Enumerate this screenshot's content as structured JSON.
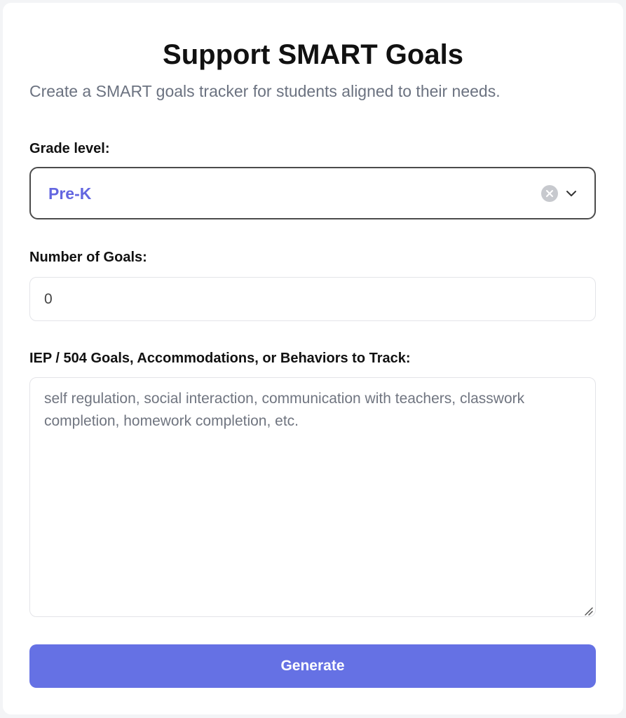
{
  "form": {
    "title": "Support SMART Goals",
    "subtitle": "Create a SMART goals tracker for students aligned to their needs.",
    "grade": {
      "label": "Grade level:",
      "value": "Pre-K",
      "clear_icon": "clear-circle-x-icon",
      "toggle_icon": "chevron-down-icon"
    },
    "goals": {
      "label": "Number of Goals:",
      "value": "0"
    },
    "iep": {
      "label": "IEP / 504 Goals, Accommodations, or Behaviors to Track:",
      "placeholder": "self regulation, social interaction, communication with teachers, classwork completion, homework completion, etc.",
      "value": ""
    },
    "generate_label": "Generate"
  },
  "colors": {
    "accent": "#6571e4",
    "selected_text": "#6366e0",
    "muted_text": "#6b7280",
    "page_background": "#f3f4f6",
    "card_background": "#ffffff"
  }
}
